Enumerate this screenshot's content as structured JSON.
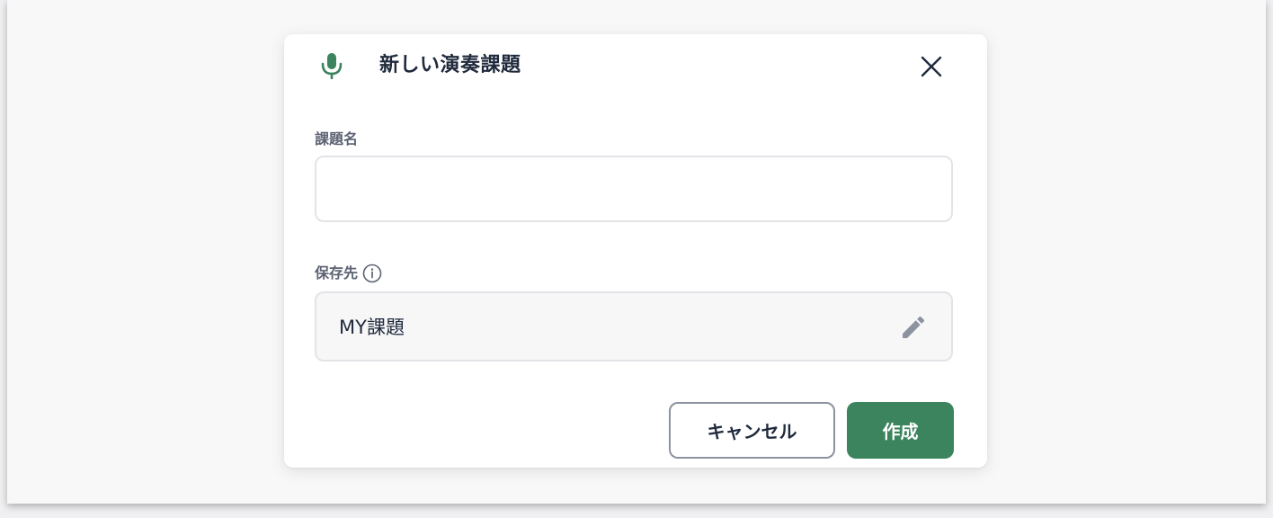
{
  "dialog": {
    "title": "新しい演奏課題",
    "title_icon": "microphone-icon",
    "close_icon": "close-icon"
  },
  "fields": {
    "name_label": "課題名",
    "name_value": "",
    "save_label": "保存先",
    "save_info_icon": "info-icon",
    "save_value": "MY課題",
    "save_edit_icon": "pencil-icon"
  },
  "actions": {
    "cancel_label": "キャンセル",
    "create_label": "作成"
  },
  "colors": {
    "accent": "#3b845e",
    "text": "#1f2a3c",
    "muted": "#5c6273",
    "icon_gray": "#8d92a1"
  }
}
